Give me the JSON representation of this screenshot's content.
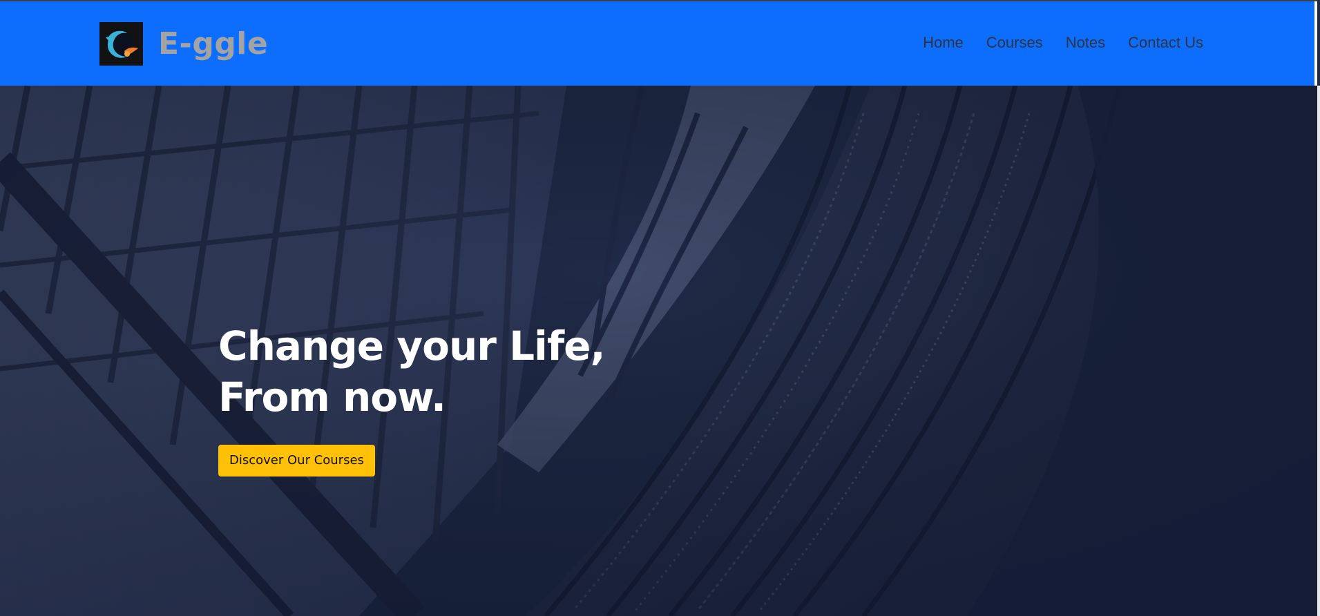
{
  "brand": {
    "name": "E-ggle",
    "logo_icon": "comet-logo-icon"
  },
  "nav": {
    "items": [
      {
        "label": "Home"
      },
      {
        "label": "Courses"
      },
      {
        "label": "Notes"
      },
      {
        "label": "Contact Us"
      }
    ]
  },
  "hero": {
    "title_line1": "Change your Life,",
    "title_line2": "From now.",
    "cta_label": "Discover Our Courses"
  },
  "colors": {
    "navbar": "#0d6efd",
    "brand_text": "#a3a3a3",
    "nav_text": "#2d3440",
    "hero_overlay": "#1f2a47",
    "cta": "#ffc107"
  }
}
